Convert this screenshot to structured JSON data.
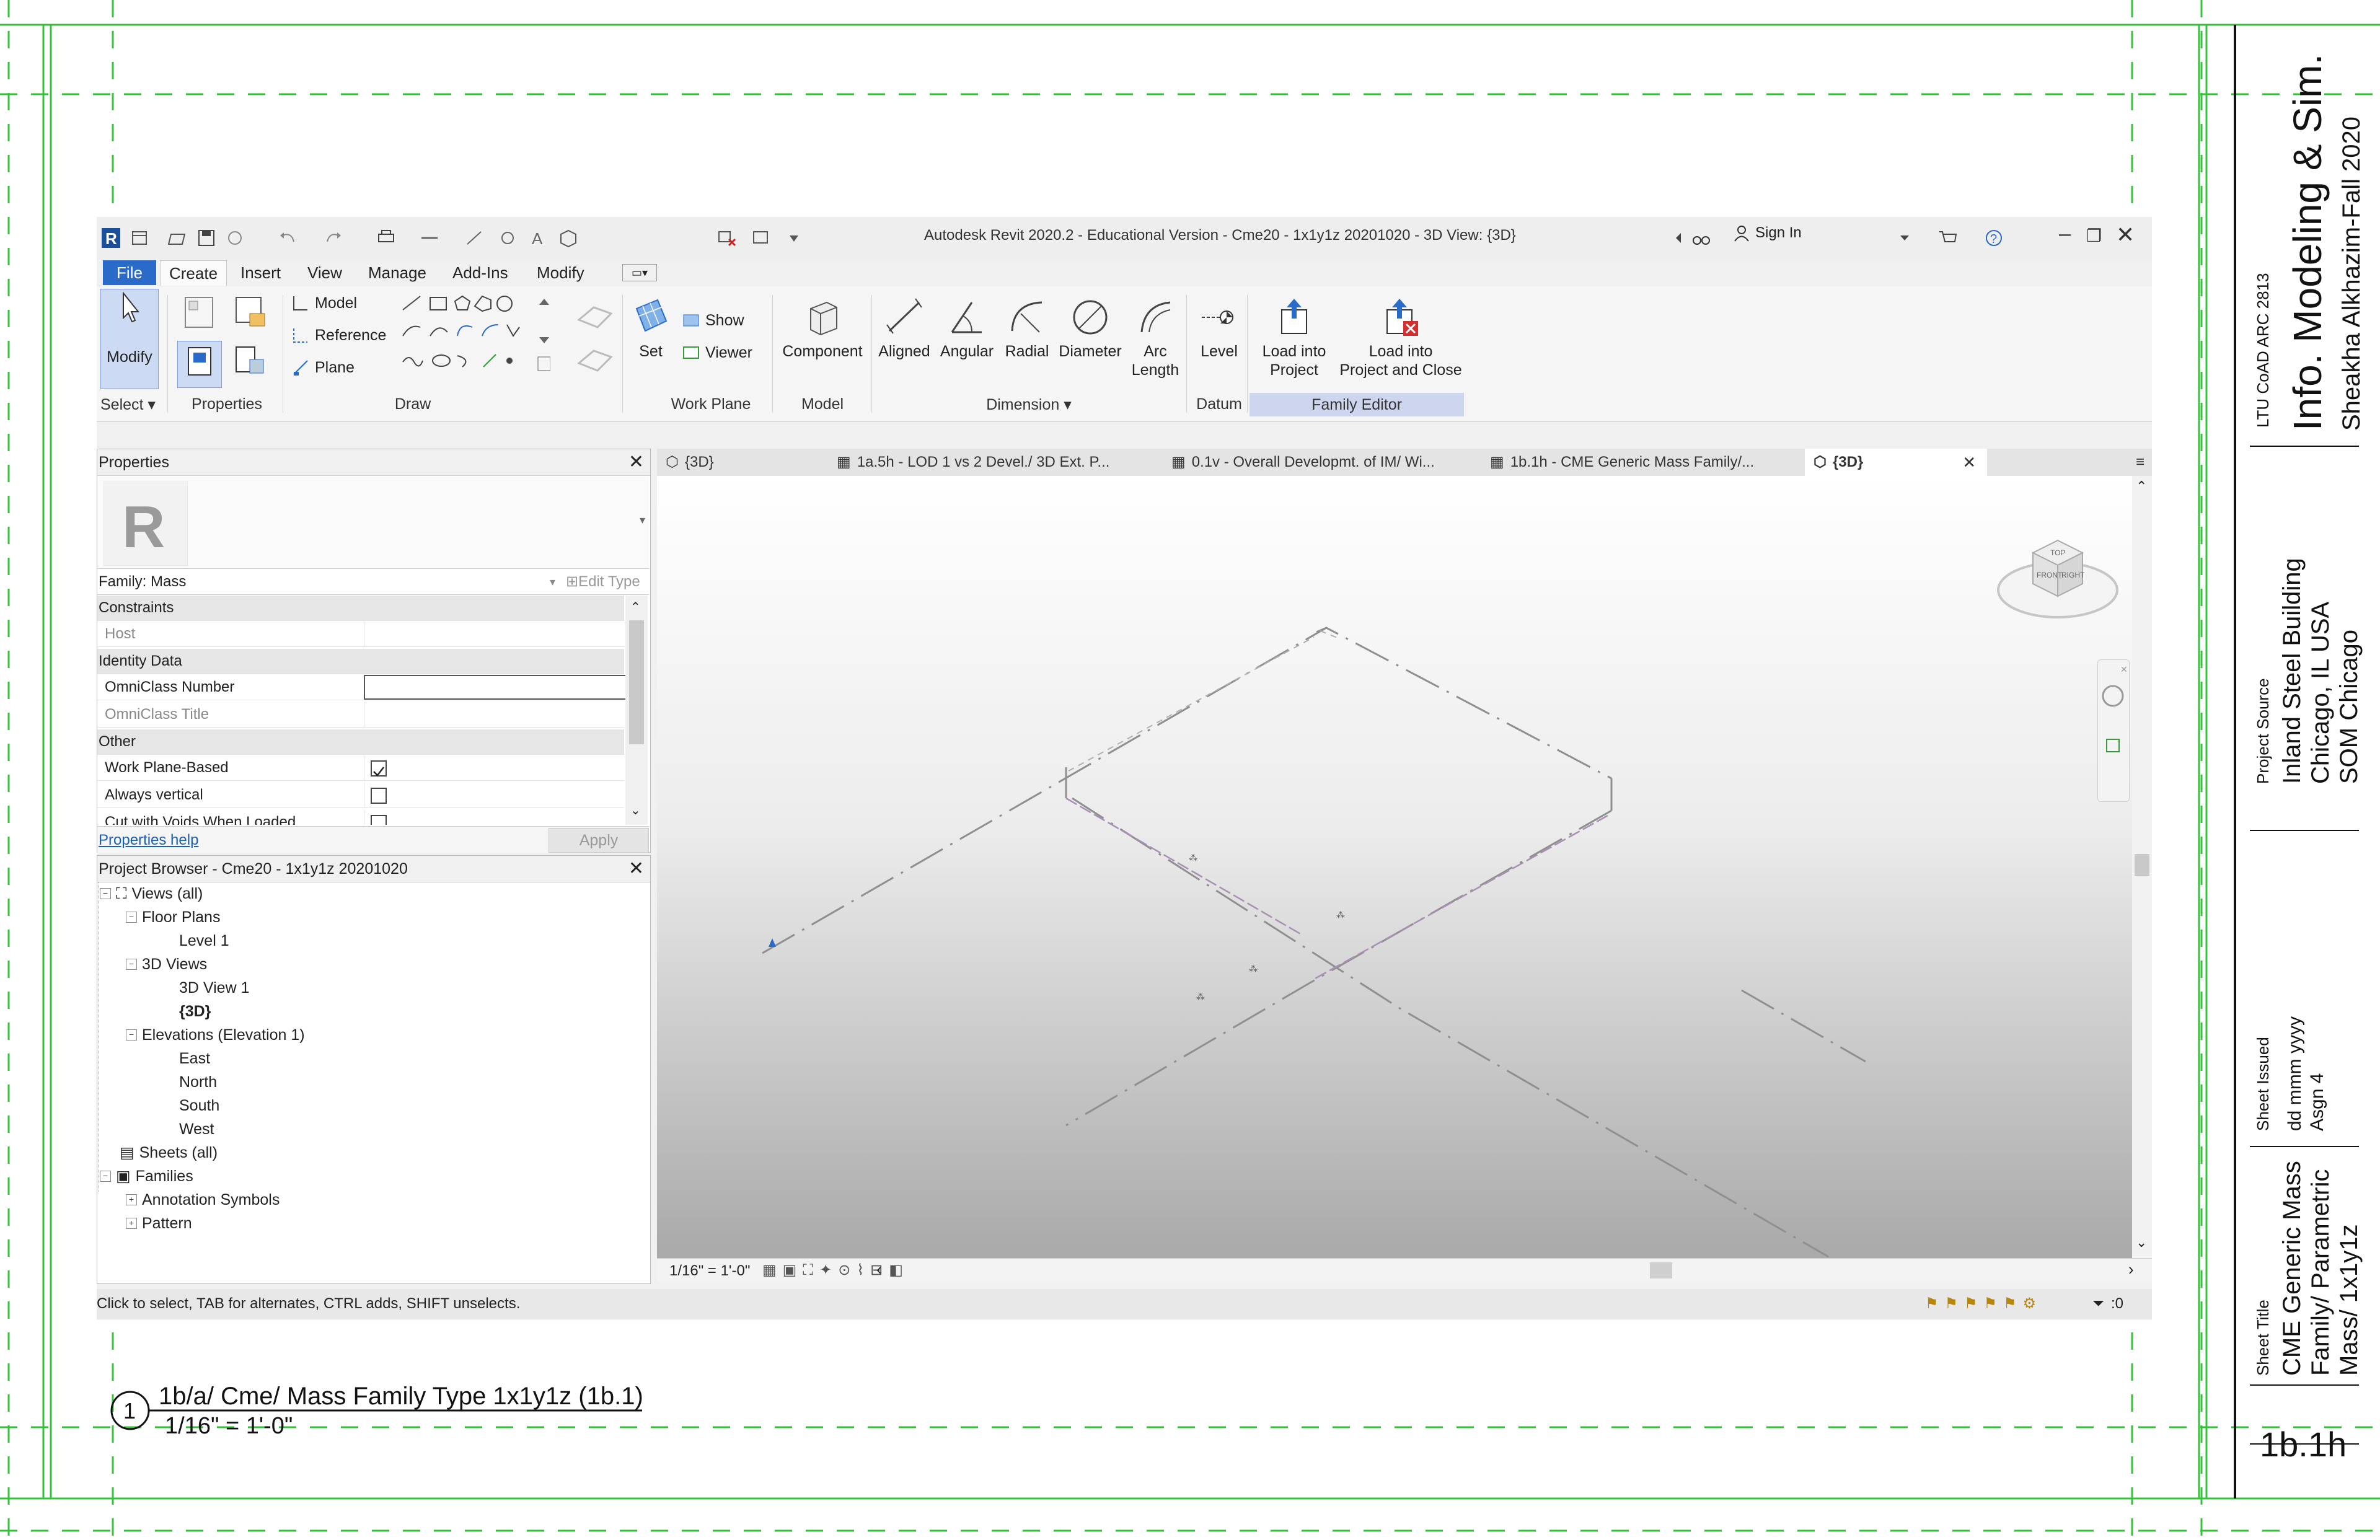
{
  "app": {
    "title": "Autodesk Revit 2020.2 - Educational Version - Cme20 - 1x1y1z 20201020 - 3D View: {3D}",
    "sign_in": "Sign In"
  },
  "ribbon": {
    "tabs": [
      "File",
      "Create",
      "Insert",
      "View",
      "Manage",
      "Add-Ins",
      "Modify"
    ],
    "active_tab": "Create",
    "modify": "Modify",
    "select_label": "Select",
    "properties_label": "Properties",
    "draw": {
      "model": "Model",
      "reference": "Reference",
      "plane": "Plane",
      "label": "Draw"
    },
    "work_plane": {
      "set": "Set",
      "show": "Show",
      "viewer": "Viewer",
      "label": "Work Plane"
    },
    "model": {
      "component": "Component",
      "label": "Model"
    },
    "dimension": {
      "aligned": "Aligned",
      "angular": "Angular",
      "radial": "Radial",
      "diameter": "Diameter",
      "arc_length_1": "Arc",
      "arc_length_2": "Length",
      "label": "Dimension"
    },
    "datum": {
      "level": "Level",
      "label": "Datum"
    },
    "family_editor": {
      "load_project_1": "Load into",
      "load_project_2": "Project",
      "load_close_1": "Load into",
      "load_close_2": "Project and Close",
      "label": "Family Editor"
    }
  },
  "properties": {
    "title": "Properties",
    "family": "Family: Mass",
    "edit_type": "Edit Type",
    "rows": {
      "constraints": "Constraints",
      "host": "Host",
      "identity": "Identity Data",
      "omniclass_number": "OmniClass Number",
      "omniclass_title": "OmniClass Title",
      "other": "Other",
      "work_plane_based": "Work Plane-Based",
      "always_vertical": "Always vertical",
      "cut_voids": "Cut with Voids When Loaded"
    },
    "work_plane_based_checked": true,
    "always_vertical_checked": false,
    "help": "Properties help",
    "apply": "Apply"
  },
  "browser": {
    "title": "Project Browser - Cme20 - 1x1y1z 20201020",
    "views_all": "Views (all)",
    "floor_plans": "Floor Plans",
    "level1": "Level 1",
    "views_3d": "3D Views",
    "view3d_1": "3D View 1",
    "view3d_current": "{3D}",
    "elevations": "Elevations (Elevation 1)",
    "east": "East",
    "north": "North",
    "south": "South",
    "west": "West",
    "sheets": "Sheets (all)",
    "families": "Families",
    "annotation_symbols": "Annotation Symbols",
    "pattern": "Pattern"
  },
  "view_tabs": [
    "{3D}",
    "1a.5h - LOD 1 vs 2 Devel./ 3D Ext. P...",
    "0.1v - Overall Developmt. of IM/ Wi...",
    "1b.1h - CME Generic Mass Family/...",
    "{3D}"
  ],
  "viewcube": {
    "top": "TOP",
    "front": "FRONT",
    "right": "RIGHT"
  },
  "view_scale": "1/16\" = 1'-0\"",
  "status": "Click to select, TAB for alternates, CTRL adds, SHIFT unselects.",
  "filter_count": ":0",
  "sheet": {
    "view_number": "1",
    "view_title": "1b/a/ Cme/ Mass Family Type 1x1y1z (1b.1)",
    "view_scale": "1/16\" = 1'-0\"",
    "course": "LTU CoAD ARC 2813",
    "course_title": "Info. Modeling & Sim.",
    "author": "Sheakha Alkhazim-Fall 2020",
    "project_source_label": "Project Source",
    "project_line1": "Inland Steel Building",
    "project_line2": "Chicago, IL USA",
    "project_line3": "SOM Chicago",
    "sheet_issued_label": "Sheet Issued",
    "issued_date": "dd mmm yyyy",
    "issued_asgn": "Asgn 4",
    "sheet_title_label": "Sheet Title",
    "title_line1": "CME Generic Mass",
    "title_line2": "Family/ Parametric",
    "title_line3": "Mass/ 1x1y1z",
    "sheet_number": "1b.1h"
  },
  "colors": {
    "guide_green": "#34c23a",
    "file_tab_blue": "#2a6ac8",
    "family_editor_bg": "#cdd6ee"
  }
}
